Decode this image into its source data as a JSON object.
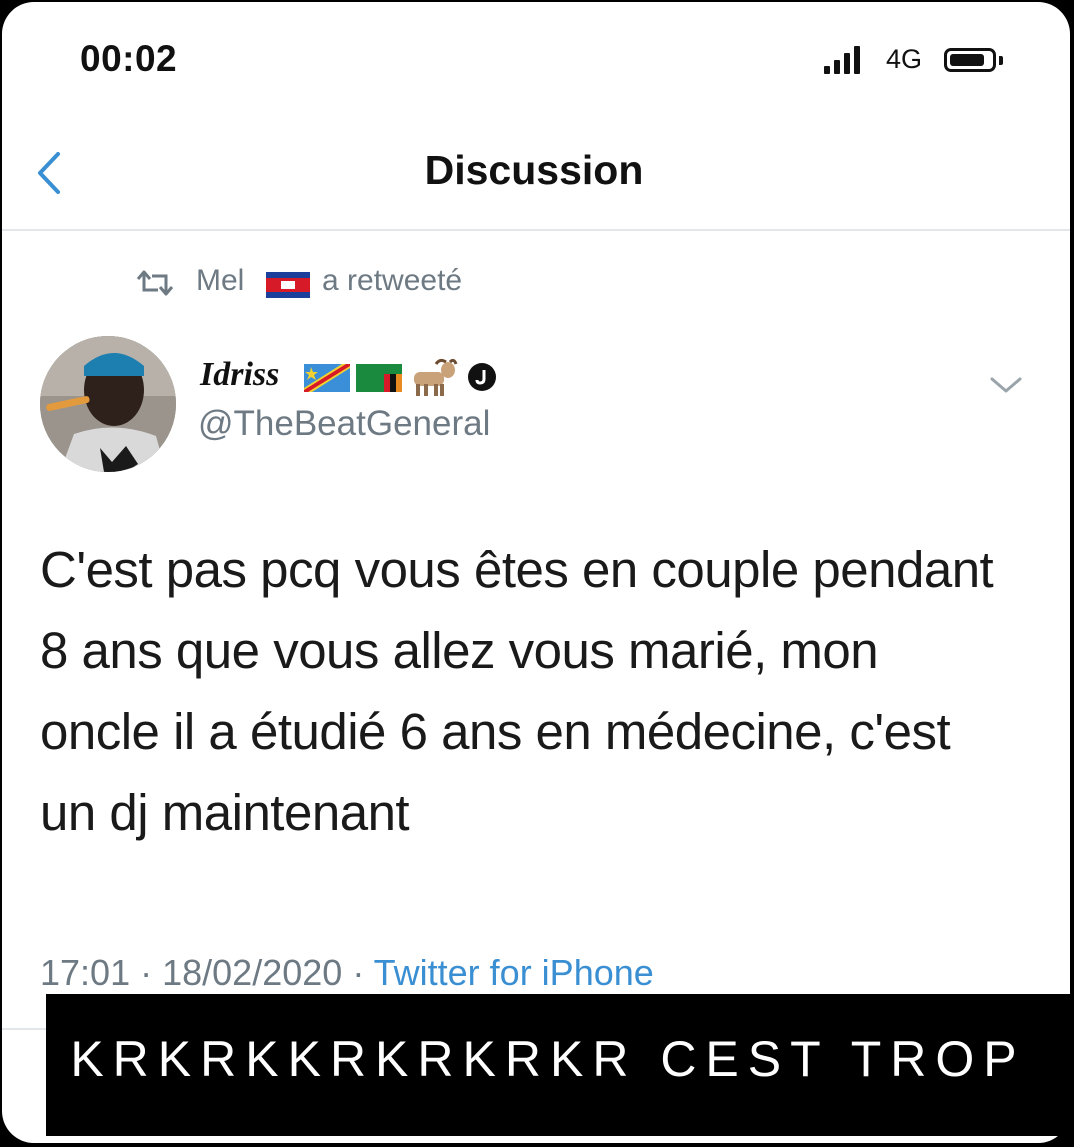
{
  "status_bar": {
    "time": "00:02",
    "network": "4G",
    "signal_bars": 4,
    "battery_level": 0.85
  },
  "header": {
    "back_icon": "chevron-left-icon",
    "title": "Discussion"
  },
  "retweet": {
    "icon": "retweet-icon",
    "user": "Mel",
    "flag": "flag-cambodia",
    "action": "a retweeté"
  },
  "tweet": {
    "author_name": "Idriss",
    "author_badges": [
      "flag-drc",
      "flag-zambia",
      "goat-icon",
      "verified-icon"
    ],
    "author_handle": "@TheBeatGeneral",
    "text": "C'est pas pcq vous êtes en couple pendant 8 ans que vous allez vous marié, mon oncle il a étudié 6 ans en médecine, c'est un dj maintenant",
    "time": "17:01",
    "date": "18/02/2020",
    "source": "Twitter for iPhone"
  },
  "caption": {
    "text": "KRKRKKRKRKRKR CEST TROP"
  },
  "colors": {
    "link_blue": "#3a8fd3",
    "muted_gray": "#6e7a83",
    "text": "#1a1a1a"
  }
}
